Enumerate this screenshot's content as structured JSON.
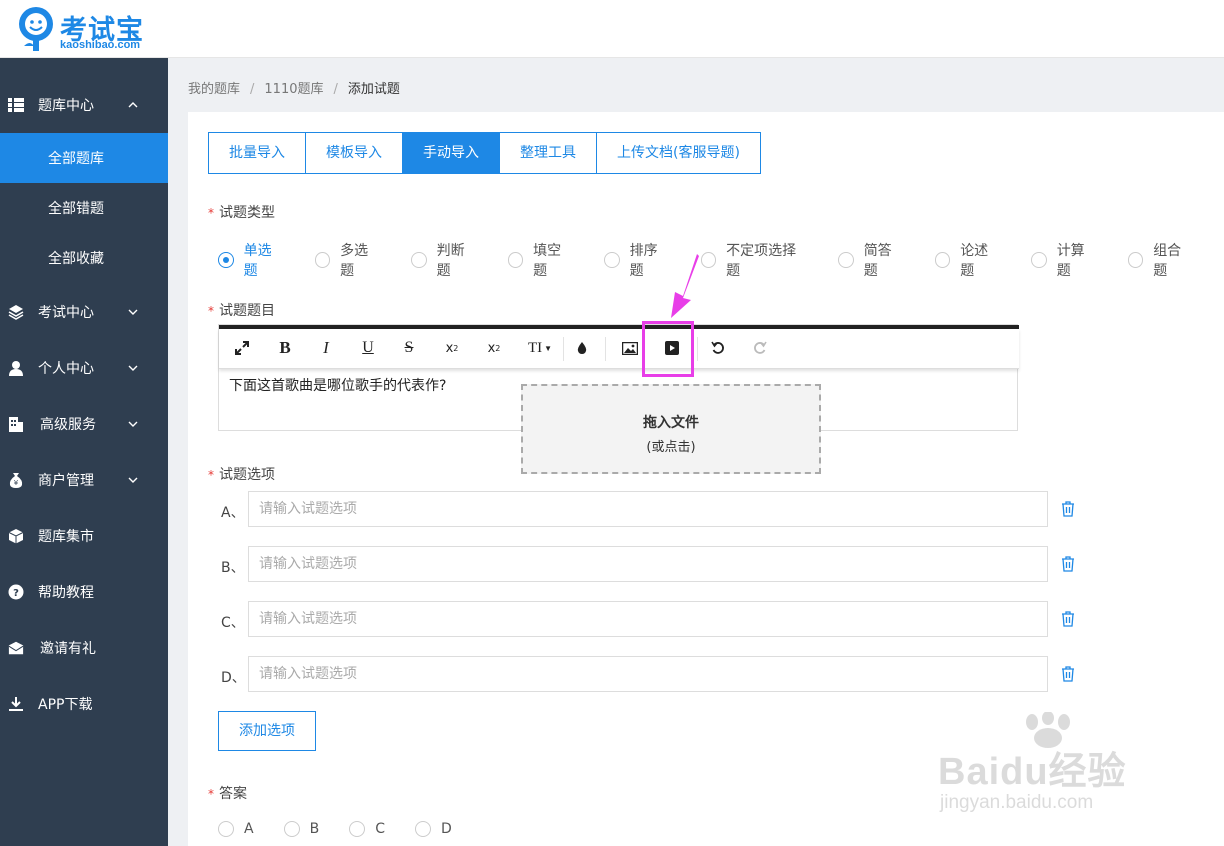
{
  "logo": {
    "name": "考试宝",
    "domain": "kaoshibao.com"
  },
  "sidebar": {
    "groups": [
      {
        "label": "题库中心",
        "icon": "list-icon"
      },
      {
        "label": "考试中心",
        "icon": "layers-icon"
      },
      {
        "label": "个人中心",
        "icon": "user-icon"
      },
      {
        "label": "高级服务",
        "icon": "building-icon"
      },
      {
        "label": "商户管理",
        "icon": "money-bag-icon"
      },
      {
        "label": "题库集市",
        "icon": "box-icon"
      },
      {
        "label": "帮助教程",
        "icon": "help-icon"
      },
      {
        "label": "邀请有礼",
        "icon": "envelope-icon"
      },
      {
        "label": "APP下载",
        "icon": "download-icon"
      }
    ],
    "sub_items": [
      {
        "label": "全部题库",
        "active": true
      },
      {
        "label": "全部错题",
        "active": false
      },
      {
        "label": "全部收藏",
        "active": false
      }
    ]
  },
  "breadcrumb": {
    "items": [
      "我的题库",
      "1110题库",
      "添加试题"
    ],
    "separator": "/"
  },
  "tabs": [
    {
      "label": "批量导入",
      "active": false
    },
    {
      "label": "模板导入",
      "active": false
    },
    {
      "label": "手动导入",
      "active": true
    },
    {
      "label": "整理工具",
      "active": false
    },
    {
      "label": "上传文档(客服导题)",
      "active": false
    }
  ],
  "form": {
    "type_label": "试题类型",
    "question_types": [
      "单选题",
      "多选题",
      "判断题",
      "填空题",
      "排序题",
      "不定项选择题",
      "简答题",
      "论述题",
      "计算题",
      "组合题"
    ],
    "selected_type": "单选题",
    "stem_label": "试题题目",
    "stem_text": "下面这首歌曲是哪位歌手的代表作?",
    "toolbar": [
      "fullscreen-icon",
      "bold-icon",
      "italic-icon",
      "underline-icon",
      "strikethrough-icon",
      "subscript-icon",
      "superscript-icon",
      "font-size-icon",
      "color-drop-icon",
      "image-icon",
      "video-icon",
      "undo-icon",
      "redo-icon"
    ],
    "dropzone": {
      "title": "拖入文件",
      "hint": "(或点击)"
    },
    "options_label": "试题选项",
    "options": [
      {
        "letter": "A、",
        "value": "",
        "placeholder": "请输入试题选项"
      },
      {
        "letter": "B、",
        "value": "",
        "placeholder": "请输入试题选项"
      },
      {
        "letter": "C、",
        "value": "",
        "placeholder": "请输入试题选项"
      },
      {
        "letter": "D、",
        "value": "",
        "placeholder": "请输入试题选项"
      }
    ],
    "add_option_label": "添加选项",
    "answer_label": "答案",
    "answer_choices": [
      "A",
      "B",
      "C",
      "D"
    ]
  },
  "colors": {
    "accent": "#1e88e5",
    "sidebar_bg": "#2f3e50",
    "highlight": "#e83ee8",
    "required": "#e53935"
  },
  "watermark": {
    "text": "Baidu经验",
    "sub": "jingyan.baidu.com"
  }
}
